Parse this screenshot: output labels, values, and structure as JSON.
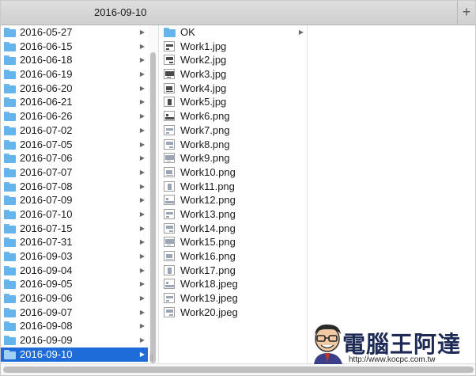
{
  "tab": {
    "title": "2016-09-10",
    "add_label": "+"
  },
  "column1": {
    "items": [
      {
        "label": "2016-05-27"
      },
      {
        "label": "2016-06-15"
      },
      {
        "label": "2016-06-18"
      },
      {
        "label": "2016-06-19"
      },
      {
        "label": "2016-06-20"
      },
      {
        "label": "2016-06-21"
      },
      {
        "label": "2016-06-26"
      },
      {
        "label": "2016-07-02"
      },
      {
        "label": "2016-07-05"
      },
      {
        "label": "2016-07-06"
      },
      {
        "label": "2016-07-07"
      },
      {
        "label": "2016-07-08"
      },
      {
        "label": "2016-07-09"
      },
      {
        "label": "2016-07-10"
      },
      {
        "label": "2016-07-15"
      },
      {
        "label": "2016-07-31"
      },
      {
        "label": "2016-09-03"
      },
      {
        "label": "2016-09-04"
      },
      {
        "label": "2016-09-05"
      },
      {
        "label": "2016-09-06"
      },
      {
        "label": "2016-09-07"
      },
      {
        "label": "2016-09-08"
      },
      {
        "label": "2016-09-09"
      },
      {
        "label": "2016-09-10"
      }
    ],
    "selected": "2016-09-10",
    "item_icon": "folder-icon"
  },
  "column2": {
    "items": [
      {
        "label": "OK",
        "kind": "folder"
      },
      {
        "label": "Work1.jpg",
        "kind": "image"
      },
      {
        "label": "Work2.jpg",
        "kind": "image"
      },
      {
        "label": "Work3.jpg",
        "kind": "image"
      },
      {
        "label": "Work4.jpg",
        "kind": "image"
      },
      {
        "label": "Work5.jpg",
        "kind": "image"
      },
      {
        "label": "Work6.png",
        "kind": "image"
      },
      {
        "label": "Work7.png",
        "kind": "image"
      },
      {
        "label": "Work8.png",
        "kind": "image"
      },
      {
        "label": "Work9.png",
        "kind": "image"
      },
      {
        "label": "Work10.png",
        "kind": "image"
      },
      {
        "label": "Work11.png",
        "kind": "image"
      },
      {
        "label": "Work12.png",
        "kind": "image"
      },
      {
        "label": "Work13.png",
        "kind": "image"
      },
      {
        "label": "Work14.png",
        "kind": "image"
      },
      {
        "label": "Work15.png",
        "kind": "image"
      },
      {
        "label": "Work16.png",
        "kind": "image"
      },
      {
        "label": "Work17.png",
        "kind": "image"
      },
      {
        "label": "Work18.jpeg",
        "kind": "image"
      },
      {
        "label": "Work19.jpeg",
        "kind": "image"
      },
      {
        "label": "Work20.jpeg",
        "kind": "image"
      }
    ]
  },
  "watermark": {
    "title": "電腦王阿達",
    "url": "http://www.kocpc.com.tw"
  },
  "colors": {
    "selection": "#1d6cd9",
    "folder": "#66b4ec"
  }
}
